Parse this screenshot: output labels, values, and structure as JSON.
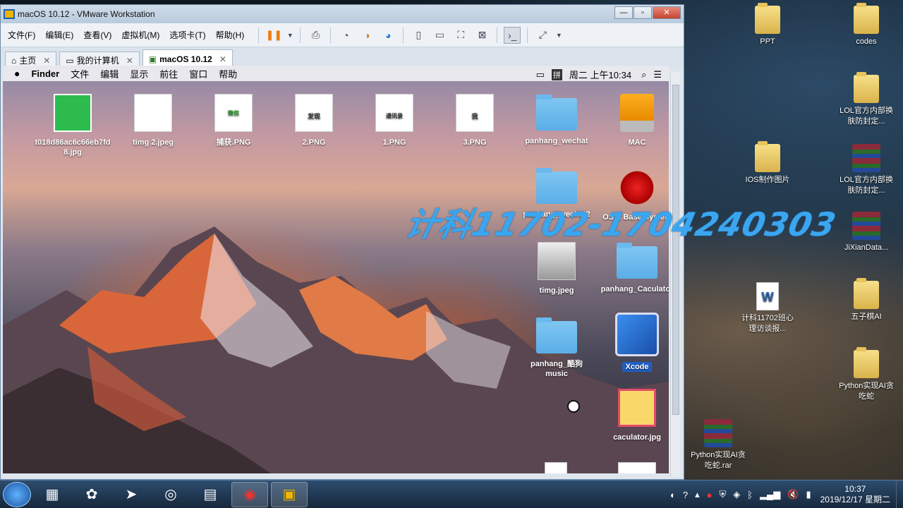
{
  "vmware": {
    "title": "macOS 10.12 - VMware Workstation",
    "menu": [
      "文件(F)",
      "编辑(E)",
      "查看(V)",
      "虚拟机(M)",
      "选项卡(T)",
      "帮助(H)"
    ],
    "tabs": [
      {
        "label": "主页"
      },
      {
        "label": "我的计算机"
      },
      {
        "label": "macOS 10.12"
      }
    ]
  },
  "mac": {
    "menubar": [
      "Finder",
      "文件",
      "编辑",
      "显示",
      "前往",
      "窗口",
      "帮助"
    ],
    "input_label": "拼",
    "clock": "周二 上午10:34",
    "icons": [
      {
        "label": "t018d86ac6c66eb7fd8.jpg",
        "kind": "wechat"
      },
      {
        "label": "timg 2.jpeg",
        "kind": "sketch"
      },
      {
        "label": "捕获.PNG",
        "kind": "wechat-shot",
        "thumb_text": "微信"
      },
      {
        "label": "2.PNG",
        "kind": "discover",
        "thumb_text": "发现"
      },
      {
        "label": "1.PNG",
        "kind": "contacts",
        "thumb_text": "通讯录"
      },
      {
        "label": "3.PNG",
        "kind": "me",
        "thumb_text": "我"
      },
      {
        "label": "panhang_wechat",
        "kind": "folder"
      },
      {
        "label": "MAC",
        "kind": "drive"
      },
      {
        "label": "panhang_wechat2",
        "kind": "folder"
      },
      {
        "label": "OS X Base System",
        "kind": "installer"
      },
      {
        "label": "timg.jpeg",
        "kind": "photo"
      },
      {
        "label": "panhang_Caculator",
        "kind": "folder"
      },
      {
        "label": "panhang_酷狗music",
        "kind": "folder"
      },
      {
        "label": "Xcode",
        "kind": "xcode"
      },
      {
        "label": "caculator.jpg",
        "kind": "calc"
      }
    ]
  },
  "watermark": "计科11702-1704240303",
  "desktop": {
    "icons": [
      {
        "label": "PPT"
      },
      {
        "label": "codes"
      },
      {
        "label": "LOL官方内部换肤防封定..."
      },
      {
        "label": "IOS制作图片"
      },
      {
        "label": "LOL官方内部换肤防封定..."
      },
      {
        "label": "JiXianData..."
      },
      {
        "label": "计科11702班心理访谈报..."
      },
      {
        "label": "五子棋AI"
      },
      {
        "label": "Python实现AI贪吃蛇"
      },
      {
        "label": "Python实现AI贪吃蛇.rar"
      }
    ]
  },
  "taskbar": {
    "time": "10:37",
    "date": "2019/12/17 星期二"
  }
}
